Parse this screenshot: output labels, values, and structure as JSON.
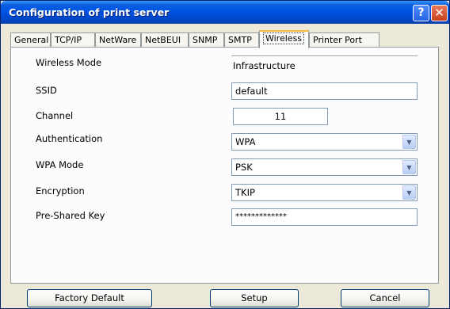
{
  "window": {
    "title": "Configuration of print server",
    "help_glyph": "?",
    "close_glyph": "✕"
  },
  "tabs": [
    {
      "label": "General"
    },
    {
      "label": "TCP/IP"
    },
    {
      "label": "NetWare"
    },
    {
      "label": "NetBEUI"
    },
    {
      "label": "SNMP"
    },
    {
      "label": "SMTP"
    },
    {
      "label": "Wireless",
      "active": true
    },
    {
      "label": "Printer Port"
    }
  ],
  "wireless": {
    "wireless_mode_label": "Wireless Mode",
    "wireless_mode_value": "Infrastructure",
    "ssid_label": "SSID",
    "ssid_value": "default",
    "channel_label": "Channel",
    "channel_value": "11",
    "authentication_label": "Authentication",
    "authentication_value": "WPA",
    "wpa_mode_label": "WPA Mode",
    "wpa_mode_value": "PSK",
    "encryption_label": "Encryption",
    "encryption_value": "TKIP",
    "psk_label": "Pre-Shared Key",
    "psk_value": "*************",
    "dropdown_icon": "chevron-down-icon"
  },
  "buttons": {
    "factory_default": "Factory Default",
    "setup": "Setup",
    "cancel": "Cancel"
  },
  "colors": {
    "titlebar": "#0054e3",
    "active_tab_accent": "#f7b93c",
    "panel_bg": "#fcfcfe",
    "window_bg": "#ece9d8"
  }
}
